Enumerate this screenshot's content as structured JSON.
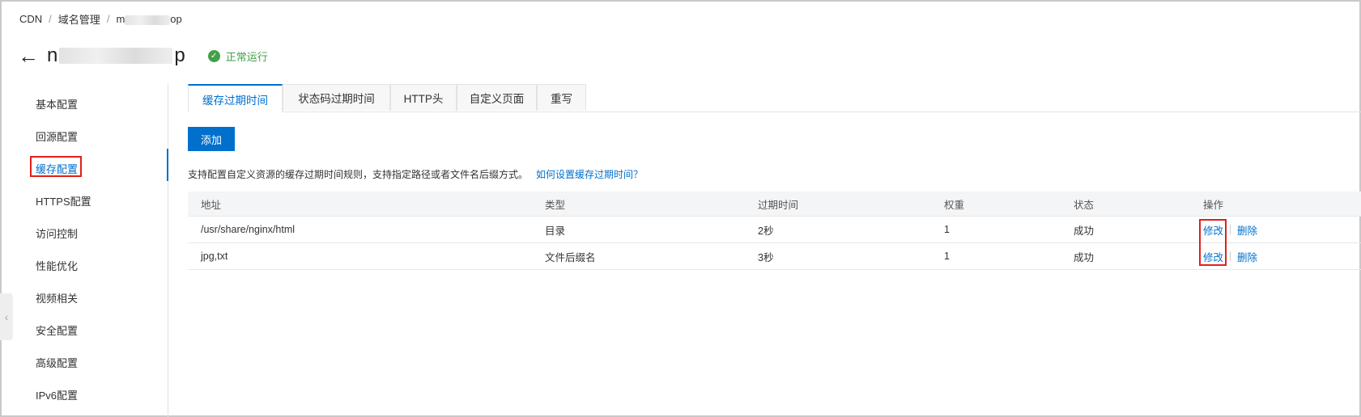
{
  "breadcrumb": {
    "items": [
      "CDN",
      "域名管理",
      "m"
    ],
    "last_suffix": "op",
    "separator": "/"
  },
  "header": {
    "domain_prefix": "n",
    "domain_suffix": "p",
    "status_text": "正常运行",
    "status_color": "#43a047"
  },
  "sidebar": {
    "items": [
      {
        "label": "基本配置"
      },
      {
        "label": "回源配置"
      },
      {
        "label": "缓存配置"
      },
      {
        "label": "HTTPS配置"
      },
      {
        "label": "访问控制"
      },
      {
        "label": "性能优化"
      },
      {
        "label": "视频相关"
      },
      {
        "label": "安全配置"
      },
      {
        "label": "高级配置"
      },
      {
        "label": "IPv6配置"
      }
    ],
    "active_index": 2
  },
  "tabs": [
    {
      "label": "缓存过期时间",
      "active": true
    },
    {
      "label": "状态码过期时间",
      "active": false
    },
    {
      "label": "HTTP头",
      "active": false
    },
    {
      "label": "自定义页面",
      "active": false
    },
    {
      "label": "重写",
      "active": false
    }
  ],
  "toolbar": {
    "add_label": "添加"
  },
  "description": {
    "text": "支持配置自定义资源的缓存过期时间规则，支持指定路径或者文件名后缀方式。",
    "help_link": "如何设置缓存过期时间？"
  },
  "table": {
    "columns": [
      "地址",
      "类型",
      "过期时间",
      "权重",
      "状态",
      "操作"
    ],
    "rows": [
      {
        "address": "/usr/share/nginx/html",
        "type": "目录",
        "expire": "2秒",
        "weight": "1",
        "status": "成功",
        "edit": "修改",
        "delete": "删除"
      },
      {
        "address": "jpg,txt",
        "type": "文件后缀名",
        "expire": "3秒",
        "weight": "1",
        "status": "成功",
        "edit": "修改",
        "delete": "删除"
      }
    ]
  },
  "colors": {
    "accent": "#0070cc",
    "highlight": "#e0201a",
    "success": "#43a047"
  },
  "icons": {
    "back": "arrow-left-icon",
    "status": "check-circle-icon",
    "collapse": "chevron-left-icon"
  }
}
